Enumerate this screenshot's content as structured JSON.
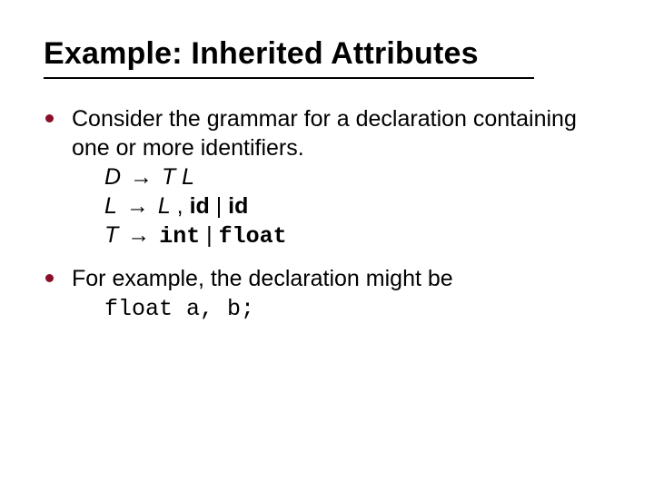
{
  "title": "Example: Inherited Attributes",
  "bullets": [
    {
      "text": "Consider the grammar for a declaration containing one or more identifiers."
    },
    {
      "text": "For example, the declaration might be"
    }
  ],
  "grammar": {
    "rule1": {
      "lhs": "D",
      "arrow": "→",
      "rhs_a": "T L"
    },
    "rule2": {
      "lhs": "L",
      "arrow": "→",
      "rhs_a": "L",
      "comma": " , ",
      "id1": "id",
      "bar": " | ",
      "id2": "id"
    },
    "rule3": {
      "lhs": "T",
      "arrow": "→",
      "int": "int",
      "bar": " | ",
      "float": "float"
    }
  },
  "example_code": "float a, b;"
}
